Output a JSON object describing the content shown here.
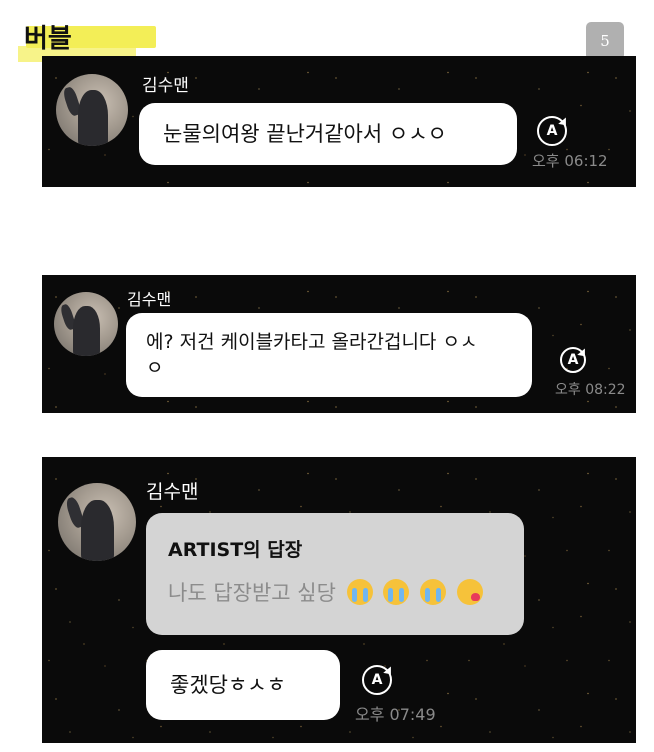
{
  "header": {
    "title": "버블",
    "page_number": "5"
  },
  "screens": [
    {
      "sender": "김수맨",
      "message": "눈물의여왕 끝난거같아서 ㅇㅅㅇ",
      "time": "오후 06:12",
      "reply_icon": "A"
    },
    {
      "sender": "김수맨",
      "message_line1": "에? 저건 케이블카타고 올라간겁니다 ㅇㅅ",
      "message_line2": "ㅇ",
      "time": "오후 08:22",
      "reply_icon": "A"
    },
    {
      "sender": "김수맨",
      "quote_title": "ARTIST의 답장",
      "quote_text": "나도 답장받고 싶당",
      "quote_emojis": [
        "crying-face",
        "crying-face",
        "crying-face",
        "kissing-face"
      ],
      "message": "좋겠당ㅎㅅㅎ",
      "time": "오후 07:49",
      "reply_icon": "A"
    }
  ],
  "colors": {
    "highlight": "#f3ee57",
    "panel_bg": "#0a0a0a",
    "bubble_bg": "#ffffff",
    "quote_bg": "#d4d4d4",
    "badge_bg": "#b0b0b0"
  }
}
